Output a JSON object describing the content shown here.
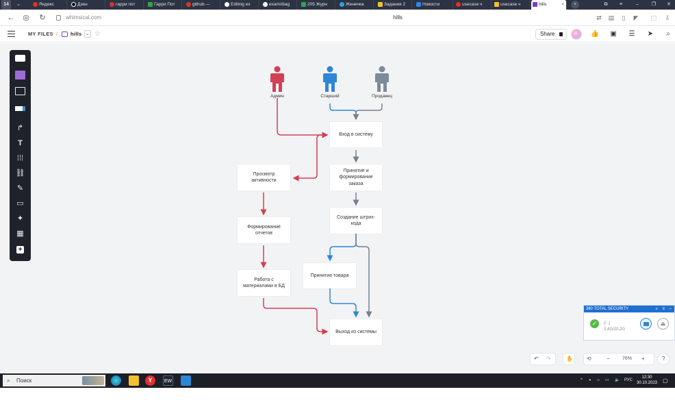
{
  "browser": {
    "tabs": [
      {
        "label": "Яндекс",
        "color": "#e0312f"
      },
      {
        "label": "Дзен",
        "color": "#111111"
      },
      {
        "label": "гарри пот",
        "color": "#e0312f"
      },
      {
        "label": "Гарри Пот",
        "color": "#2ea44f"
      },
      {
        "label": "github —",
        "color": "#e0312f"
      },
      {
        "label": "Editing ex",
        "color": "#ffffff"
      },
      {
        "label": "exam/diag",
        "color": "#ffffff"
      },
      {
        "label": "205 Журн",
        "color": "#2ea44f"
      },
      {
        "label": "Женечка",
        "color": "#2aa3e0"
      },
      {
        "label": "Задания 2",
        "color": "#f2c12e"
      },
      {
        "label": "Новости",
        "color": "#2787f5"
      },
      {
        "label": "usecase ч",
        "color": "#e0312f"
      },
      {
        "label": "usecase ч",
        "color": "#f2c12e"
      },
      {
        "label": "hills",
        "color": "#7b3fbf"
      }
    ],
    "counter": "14",
    "url": "whimsical.com",
    "page_title": "hills"
  },
  "app": {
    "breadcrumb_root": "MY FILES",
    "breadcrumb_sep": "/",
    "board_name": "hills",
    "share_label": "Share"
  },
  "diagram": {
    "actors": [
      {
        "label": "Админ",
        "color": "#d33f54"
      },
      {
        "label": "Старший",
        "color": "#2f86d6"
      },
      {
        "label": "Продавец",
        "color": "#7d8a99"
      }
    ],
    "nodes": {
      "login": "Вход в систему",
      "accept_order": "Принятие и формирование заказа",
      "barcode": "Создание штрих-кода",
      "view_activity": "Просмотр активности",
      "reports": "Формирование отчетов",
      "db_work": "Работа с материалами в БД",
      "accept_goods": "Принятие товара",
      "logout": "Выход из системы"
    }
  },
  "controls": {
    "zoom": "76%",
    "help": "?"
  },
  "security": {
    "title": "360 TOTAL SECURITY",
    "line1": "(/ .)",
    "line2": "2,4G/20,2G"
  },
  "taskbar": {
    "search": "Поиск",
    "lang": "РУС",
    "time": "12:30",
    "date": "30.10.2023"
  }
}
